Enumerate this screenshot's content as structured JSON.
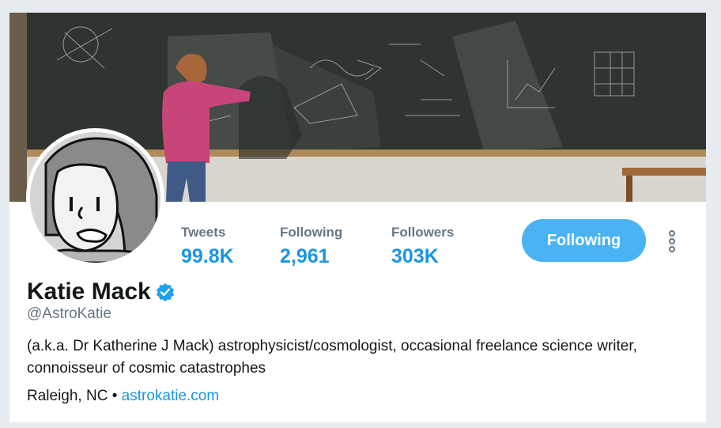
{
  "profile": {
    "name": "Katie Mack",
    "handle": "@AstroKatie",
    "verified": true,
    "bio_line1": "(a.k.a. Dr Katherine J Mack) astrophysicist/cosmologist, occasional freelance science writer,",
    "bio_line2": "connoisseur of cosmic catastrophes",
    "location": "Raleigh, NC",
    "separator": "•",
    "website": "astrokatie.com"
  },
  "stats": [
    {
      "label": "Tweets",
      "value": "99.8K"
    },
    {
      "label": "Following",
      "value": "2,961"
    },
    {
      "label": "Followers",
      "value": "303K"
    }
  ],
  "actions": {
    "follow_label": "Following",
    "more_icon": "more-vertical-icon"
  },
  "colors": {
    "accent": "#1b95e0",
    "button_bg": "#4ab3f4",
    "page_bg": "#e6ecf0",
    "muted": "#657786",
    "text": "#14171a"
  }
}
